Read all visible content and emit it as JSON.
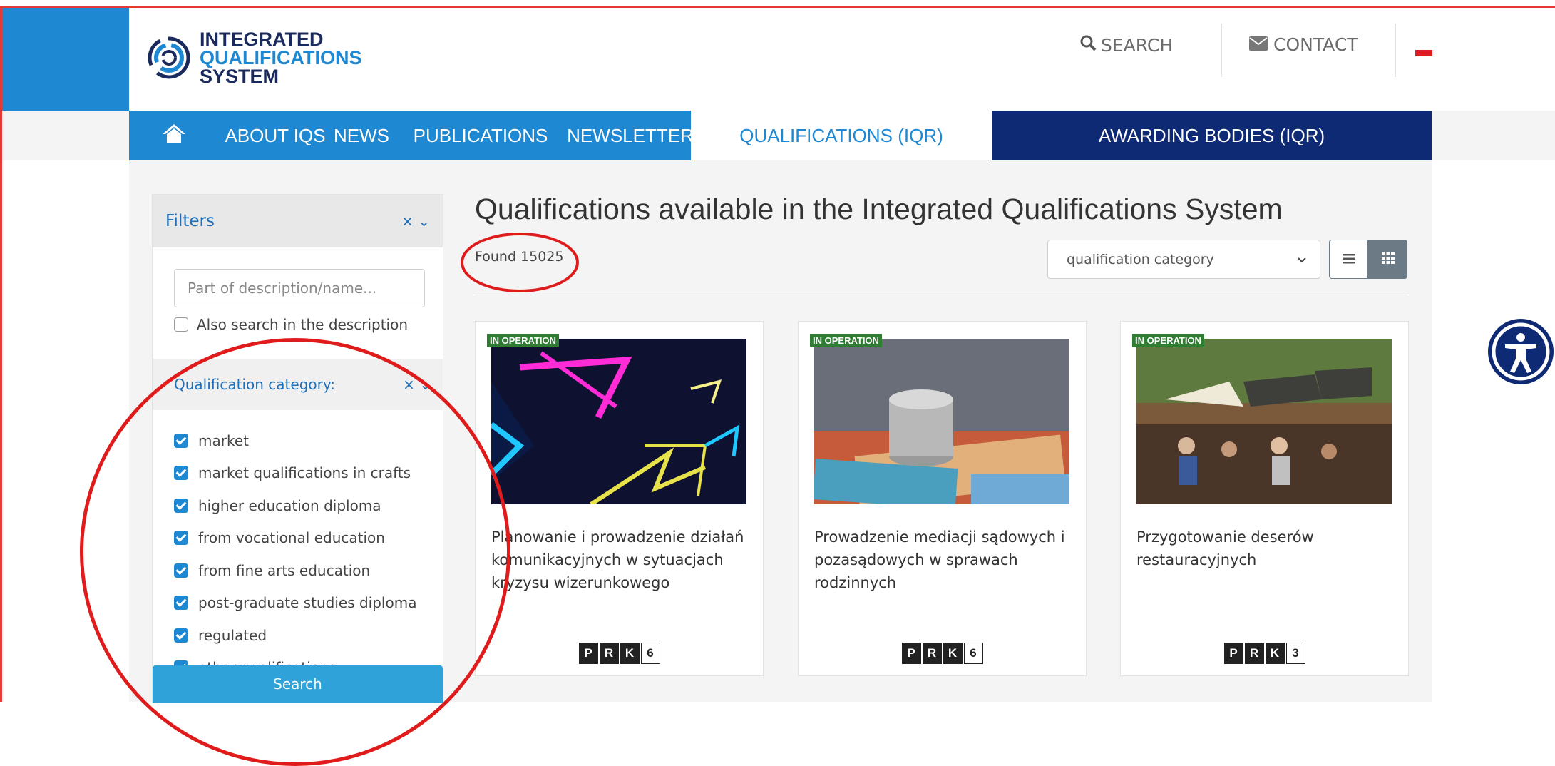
{
  "logo": {
    "line1": "INTEGRATED",
    "line2": "QUALIFICATIONS",
    "line3": "SYSTEM"
  },
  "header": {
    "search_label": "SEARCH",
    "contact_label": "CONTACT"
  },
  "nav": {
    "about": "ABOUT IQS",
    "news": "NEWS",
    "publications": "PUBLICATIONS",
    "newsletter": "NEWSLETTER",
    "qualifications": "QUALIFICATIONS (IQR)",
    "awarding": "AWARDING BODIES (IQR)"
  },
  "filters": {
    "title": "Filters",
    "controls": "× ⌄",
    "search_placeholder": "Part of description/name...",
    "also_search": "Also search in the description",
    "category_label": "Qualification category:",
    "categories": [
      "market",
      "market qualifications in crafts",
      "higher education diploma",
      "from vocational education",
      "from fine arts education",
      "post-graduate studies diploma",
      "regulated",
      "other qualifications"
    ],
    "search_button": "Search"
  },
  "results": {
    "title": "Qualifications available in the Integrated Qualifications System",
    "found": "Found 15025",
    "sort_select": "qualification category"
  },
  "cards": [
    {
      "badge": "IN OPERATION",
      "title": "Planowanie i prowadzenie działań komunikacyjnych w sytuacjach kryzysu wizerunkowego",
      "prk": [
        "P",
        "R",
        "K"
      ],
      "level": "6"
    },
    {
      "badge": "IN OPERATION",
      "title": "Prowadzenie mediacji sądowych i pozasądowych w sprawach rodzinnych",
      "prk": [
        "P",
        "R",
        "K"
      ],
      "level": "6"
    },
    {
      "badge": "IN OPERATION",
      "title": "Przygotowanie deserów restauracyjnych",
      "prk": [
        "P",
        "R",
        "K"
      ],
      "level": "3"
    }
  ],
  "colors": {
    "primary": "#1e88d2",
    "navy": "#0f2a74",
    "annotation": "#e01b1b",
    "badge": "#2e7d32"
  },
  "icons": [
    "home-icon",
    "search-icon",
    "mail-icon",
    "list-view-icon",
    "grid-view-icon",
    "accessibility-icon",
    "chevron-down-icon"
  ]
}
